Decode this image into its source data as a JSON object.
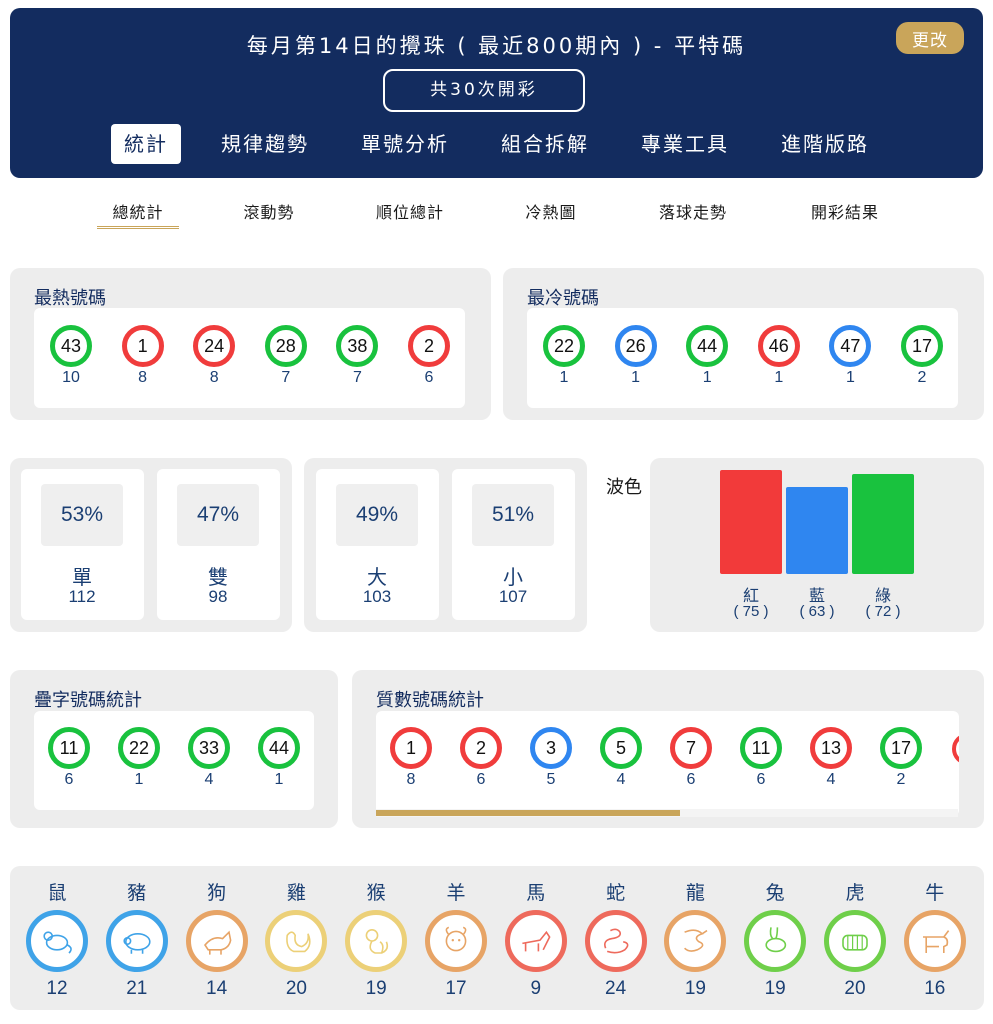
{
  "header": {
    "title": "每月第14日的攪珠 ( 最近800期內 ) - 平特碼",
    "change_label": "更改",
    "draw_count": "共30次開彩",
    "tabs": [
      "統計",
      "規律趨勢",
      "單號分析",
      "組合拆解",
      "專業工具",
      "進階版路"
    ]
  },
  "subnav": [
    "總統計",
    "滾動勢",
    "順位總計",
    "冷熱圖",
    "落球走勢",
    "開彩結果"
  ],
  "hot": {
    "title": "最熱號碼",
    "balls": [
      {
        "num": "43",
        "count": "10",
        "color": "green"
      },
      {
        "num": "1",
        "count": "8",
        "color": "red"
      },
      {
        "num": "24",
        "count": "8",
        "color": "red"
      },
      {
        "num": "28",
        "count": "7",
        "color": "green"
      },
      {
        "num": "38",
        "count": "7",
        "color": "green"
      },
      {
        "num": "2",
        "count": "6",
        "color": "red"
      }
    ]
  },
  "cold": {
    "title": "最冷號碼",
    "balls": [
      {
        "num": "22",
        "count": "1",
        "color": "green"
      },
      {
        "num": "26",
        "count": "1",
        "color": "blue"
      },
      {
        "num": "44",
        "count": "1",
        "color": "green"
      },
      {
        "num": "46",
        "count": "1",
        "color": "red"
      },
      {
        "num": "47",
        "count": "1",
        "color": "blue"
      },
      {
        "num": "17",
        "count": "2",
        "color": "green"
      }
    ]
  },
  "odd_even": [
    {
      "pct": "53%",
      "label": "單",
      "count": "112"
    },
    {
      "pct": "47%",
      "label": "雙",
      "count": "98"
    }
  ],
  "big_small": [
    {
      "pct": "49%",
      "label": "大",
      "count": "103"
    },
    {
      "pct": "51%",
      "label": "小",
      "count": "107"
    }
  ],
  "wave": {
    "title": "波色",
    "bars": [
      {
        "label": "紅",
        "value": 75,
        "count_text": "( 75 )",
        "color": "#f23a3a"
      },
      {
        "label": "藍",
        "value": 63,
        "count_text": "( 63 )",
        "color": "#2f86f0"
      },
      {
        "label": "綠",
        "value": 72,
        "count_text": "( 72 )",
        "color": "#19c23e"
      }
    ]
  },
  "repeat": {
    "title": "疊字號碼統計",
    "balls": [
      {
        "num": "11",
        "count": "6",
        "color": "green"
      },
      {
        "num": "22",
        "count": "1",
        "color": "green"
      },
      {
        "num": "33",
        "count": "4",
        "color": "green"
      },
      {
        "num": "44",
        "count": "1",
        "color": "green"
      }
    ]
  },
  "prime": {
    "title": "質數號碼統計",
    "balls": [
      {
        "num": "1",
        "count": "8",
        "color": "red"
      },
      {
        "num": "2",
        "count": "6",
        "color": "red"
      },
      {
        "num": "3",
        "count": "5",
        "color": "blue"
      },
      {
        "num": "5",
        "count": "4",
        "color": "green"
      },
      {
        "num": "7",
        "count": "6",
        "color": "red"
      },
      {
        "num": "11",
        "count": "6",
        "color": "green"
      },
      {
        "num": "13",
        "count": "4",
        "color": "red"
      },
      {
        "num": "17",
        "count": "2",
        "color": "green"
      }
    ]
  },
  "zodiac": [
    {
      "name": "鼠",
      "count": "12",
      "icon": "rat-icon",
      "ring": "#3fa3e8"
    },
    {
      "name": "豬",
      "count": "21",
      "icon": "pig-icon",
      "ring": "#3fa3e8"
    },
    {
      "name": "狗",
      "count": "14",
      "icon": "dog-icon",
      "ring": "#e7a466"
    },
    {
      "name": "雞",
      "count": "20",
      "icon": "rooster-icon",
      "ring": "#ecd078"
    },
    {
      "name": "猴",
      "count": "19",
      "icon": "monkey-icon",
      "ring": "#ecd078"
    },
    {
      "name": "羊",
      "count": "17",
      "icon": "goat-icon",
      "ring": "#e7a466"
    },
    {
      "name": "馬",
      "count": "9",
      "icon": "horse-icon",
      "ring": "#ee6a5c"
    },
    {
      "name": "蛇",
      "count": "24",
      "icon": "snake-icon",
      "ring": "#ee6a5c"
    },
    {
      "name": "龍",
      "count": "19",
      "icon": "dragon-icon",
      "ring": "#e7a466"
    },
    {
      "name": "兔",
      "count": "19",
      "icon": "rabbit-icon",
      "ring": "#6fcf4a"
    },
    {
      "name": "虎",
      "count": "20",
      "icon": "tiger-icon",
      "ring": "#6fcf4a"
    },
    {
      "name": "牛",
      "count": "16",
      "icon": "ox-icon",
      "ring": "#e7a466"
    }
  ]
}
